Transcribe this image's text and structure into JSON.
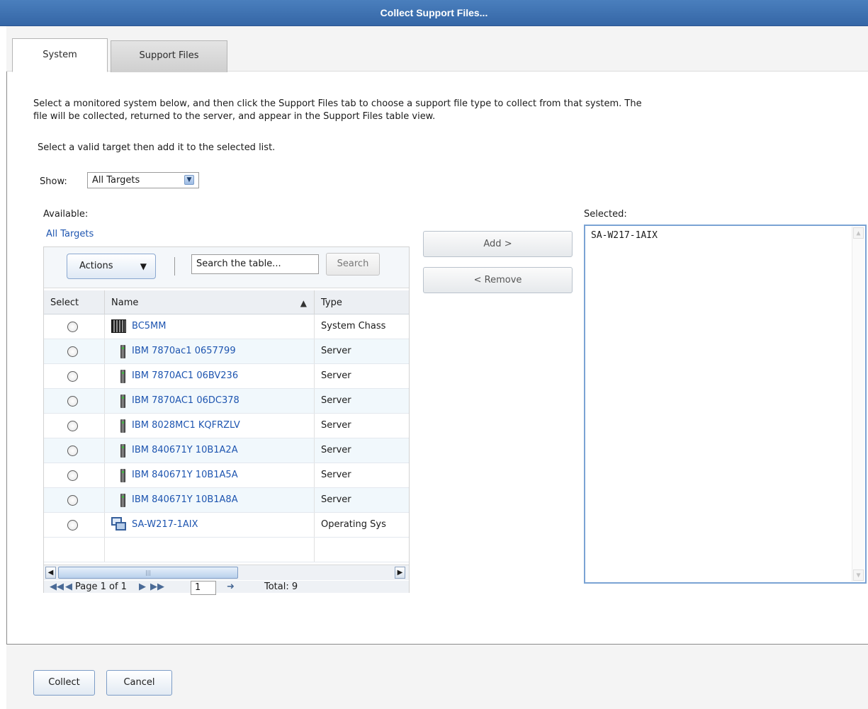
{
  "window": {
    "title": "Collect Support Files..."
  },
  "tabs": [
    {
      "label": "System",
      "active": true
    },
    {
      "label": "Support Files",
      "active": false
    }
  ],
  "intro_text": {
    "line1": "Select a monitored system below, and then click the Support Files tab to choose a support file type to collect from that system. The",
    "line2": "file will be collected, returned to the server, and appear in the Support Files table view."
  },
  "hint_text": "Select a valid target then add it to the selected list.",
  "show_filter": {
    "label": "Show:",
    "value": "All Targets"
  },
  "available": {
    "label": "Available:",
    "link": "All Targets",
    "toolbar": {
      "actions_label": "Actions",
      "search_placeholder": "Search the table...",
      "search_button": "Search"
    },
    "columns": [
      "Select",
      "Name",
      "Type"
    ],
    "rows": [
      {
        "name": "BC5MM",
        "type": "System Chass",
        "icon": "chassis-icon"
      },
      {
        "name": "IBM 7870ac1 0657799",
        "type": "Server",
        "icon": "server-icon"
      },
      {
        "name": "IBM 7870AC1 06BV236",
        "type": "Server",
        "icon": "server-icon"
      },
      {
        "name": "IBM 7870AC1 06DC378",
        "type": "Server",
        "icon": "server-icon"
      },
      {
        "name": "IBM 8028MC1 KQFRZLV",
        "type": "Server",
        "icon": "server-icon"
      },
      {
        "name": "IBM 840671Y 10B1A2A",
        "type": "Server",
        "icon": "server-icon"
      },
      {
        "name": "IBM 840671Y 10B1A5A",
        "type": "Server",
        "icon": "server-icon"
      },
      {
        "name": "IBM 840671Y 10B1A8A",
        "type": "Server",
        "icon": "server-icon"
      },
      {
        "name": "SA-W217-1AIX",
        "type": "Operating Sys",
        "icon": "operating-system-icon"
      }
    ],
    "pager": {
      "page_text": "Page 1 of 1",
      "page_value": "1",
      "total_text": "Total: 9"
    }
  },
  "buttons": {
    "add": "Add >",
    "remove": "< Remove",
    "collect": "Collect",
    "cancel": "Cancel"
  },
  "selected": {
    "label": "Selected:",
    "items": [
      "SA-W217-1AIX"
    ]
  },
  "colors": {
    "title_bar": "#3f73b4",
    "link": "#1e55b0",
    "selected_border": "#7aa3d4"
  }
}
